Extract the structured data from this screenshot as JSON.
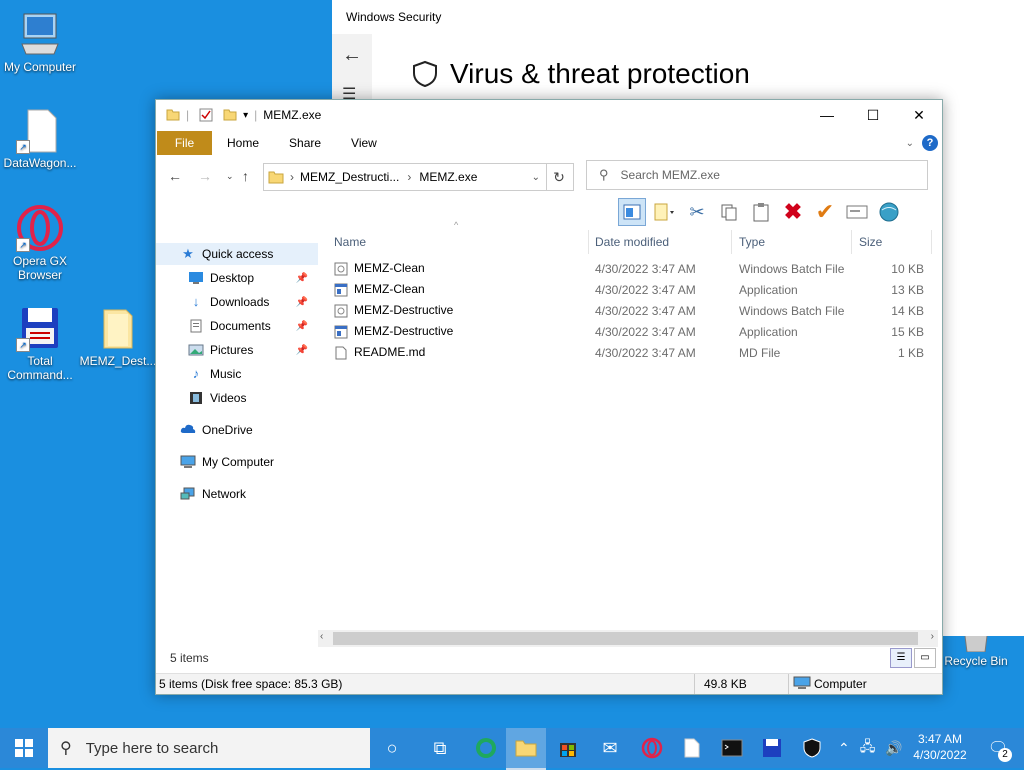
{
  "desktop": {
    "icons": [
      {
        "label": "My Computer"
      },
      {
        "label": "DataWagon..."
      },
      {
        "label": "Opera GX Browser"
      },
      {
        "label": "Total Command..."
      },
      {
        "label": "MEMZ_Dest..."
      },
      {
        "label": "Recycle Bin"
      }
    ]
  },
  "security": {
    "title": "Windows Security",
    "heading": "Virus & threat protection"
  },
  "explorer": {
    "title": "MEMZ.exe",
    "tabs": [
      "File",
      "Home",
      "Share",
      "View"
    ],
    "breadcrumb": [
      "MEMZ_Destructi...",
      "MEMZ.exe"
    ],
    "search_placeholder": "Search MEMZ.exe",
    "nav": {
      "quick_access": "Quick access",
      "desktop": "Desktop",
      "downloads": "Downloads",
      "documents": "Documents",
      "pictures": "Pictures",
      "music": "Music",
      "videos": "Videos",
      "onedrive": "OneDrive",
      "my_computer": "My Computer",
      "network": "Network"
    },
    "columns": {
      "name": "Name",
      "date": "Date modified",
      "type": "Type",
      "size": "Size"
    },
    "files": [
      {
        "name": "MEMZ-Clean",
        "date": "4/30/2022 3:47 AM",
        "type": "Windows Batch File",
        "size": "10 KB",
        "icon": "batch-icon"
      },
      {
        "name": "MEMZ-Clean",
        "date": "4/30/2022 3:47 AM",
        "type": "Application",
        "size": "13 KB",
        "icon": "application-icon"
      },
      {
        "name": "MEMZ-Destructive",
        "date": "4/30/2022 3:47 AM",
        "type": "Windows Batch File",
        "size": "14 KB",
        "icon": "batch-icon"
      },
      {
        "name": "MEMZ-Destructive",
        "date": "4/30/2022 3:47 AM",
        "type": "Application",
        "size": "15 KB",
        "icon": "application-icon"
      },
      {
        "name": "README.md",
        "date": "4/30/2022 3:47 AM",
        "type": "MD File",
        "size": "1 KB",
        "icon": "document-icon"
      }
    ],
    "items_count": "5 items",
    "status": {
      "summary": "5 items (Disk free space: 85.3 GB)",
      "size": "49.8 KB",
      "location": "Computer"
    }
  },
  "taskbar": {
    "search_placeholder": "Type here to search",
    "time": "3:47 AM",
    "date": "4/30/2022",
    "notifications": "2"
  },
  "colors": {
    "desktop": "#1a8fe0",
    "taskbar": "#2b88d8",
    "file_tab": "#c08b1a"
  }
}
